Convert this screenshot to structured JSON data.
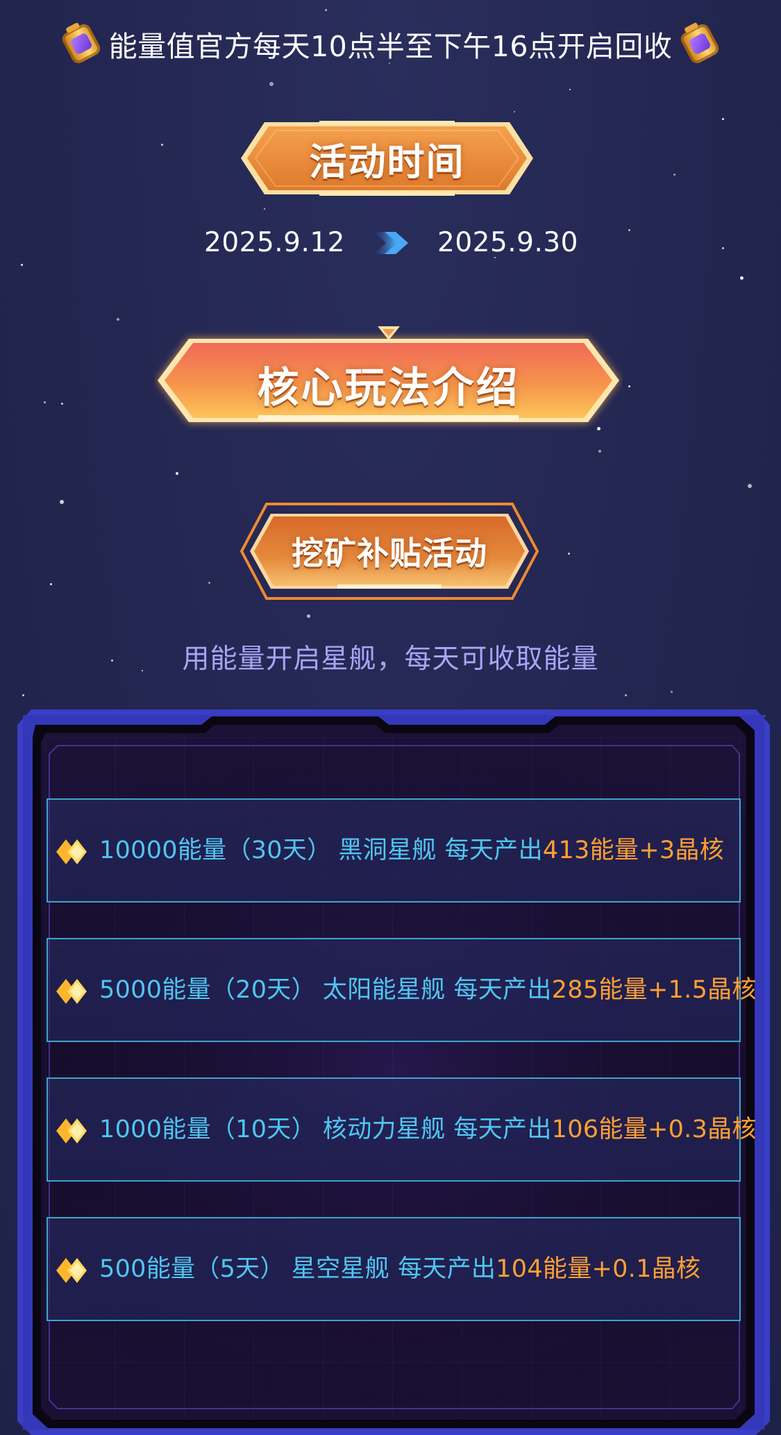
{
  "notice": {
    "text": "能量值官方每天10点半至下午16点开启回收",
    "left_icon": "battery-icon",
    "right_icon": "battery-icon"
  },
  "activity_time": {
    "title": "活动时间",
    "start_date": "2025.9.12",
    "end_date": "2025.9.30",
    "arrow_icon": "arrow-right-icon"
  },
  "core_intro": {
    "title": "核心玩法介绍"
  },
  "mining": {
    "title": "挖矿补贴活动",
    "tagline": "用能量开启星舰，每天可收取能量"
  },
  "ships": [
    {
      "cost": "10000能量（30天）",
      "name": "黑洞星舰",
      "daily_label": "每天产出",
      "reward": "413能量+3晶核"
    },
    {
      "cost": "5000能量（20天）",
      "name": "太阳能星舰",
      "daily_label": "每天产出",
      "reward": "285能量+1.5晶核"
    },
    {
      "cost": "1000能量（10天）",
      "name": "核动力星舰",
      "daily_label": "每天产出",
      "reward": "106能量+0.3晶核"
    },
    {
      "cost": "500能量（5天）",
      "name": "星空星舰",
      "daily_label": "每天产出",
      "reward": "104能量+0.1晶核"
    }
  ],
  "colors": {
    "background": "#232650",
    "text_blue": "#4fc6f0",
    "text_orange": "#ffa033",
    "tagline": "#a9a4f5",
    "row_border": "#3aa7c9",
    "panel_border": "#3c3fc2"
  }
}
